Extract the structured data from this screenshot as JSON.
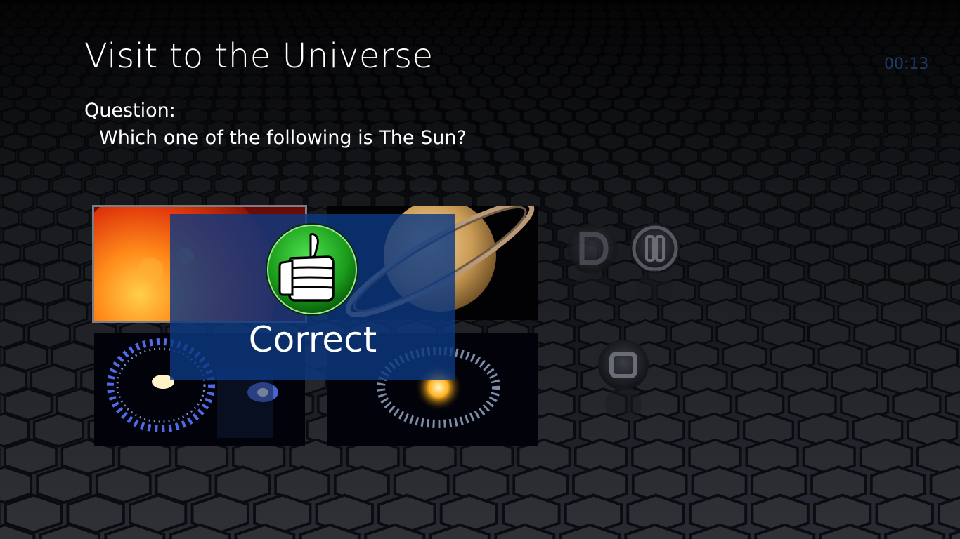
{
  "header": {
    "title": "Visit to the Universe",
    "timer": "00:13"
  },
  "question": {
    "label": "Question:",
    "text": "Which one of the following is The Sun?"
  },
  "answers": [
    {
      "name": "sun",
      "selected": true
    },
    {
      "name": "saturn",
      "selected": false
    },
    {
      "name": "cartwheel-galaxy",
      "selected": false
    },
    {
      "name": "ring-galaxy",
      "selected": false
    }
  ],
  "controls": {
    "play_icon": "play-icon",
    "pause_icon": "pause-icon",
    "stop_icon": "stop-icon"
  },
  "feedback": {
    "result": "Correct",
    "icon": "thumbs-up-icon",
    "color": "#1a9b1a"
  },
  "colors": {
    "overlay": "#0c3880",
    "timer": "#1f3a66"
  }
}
